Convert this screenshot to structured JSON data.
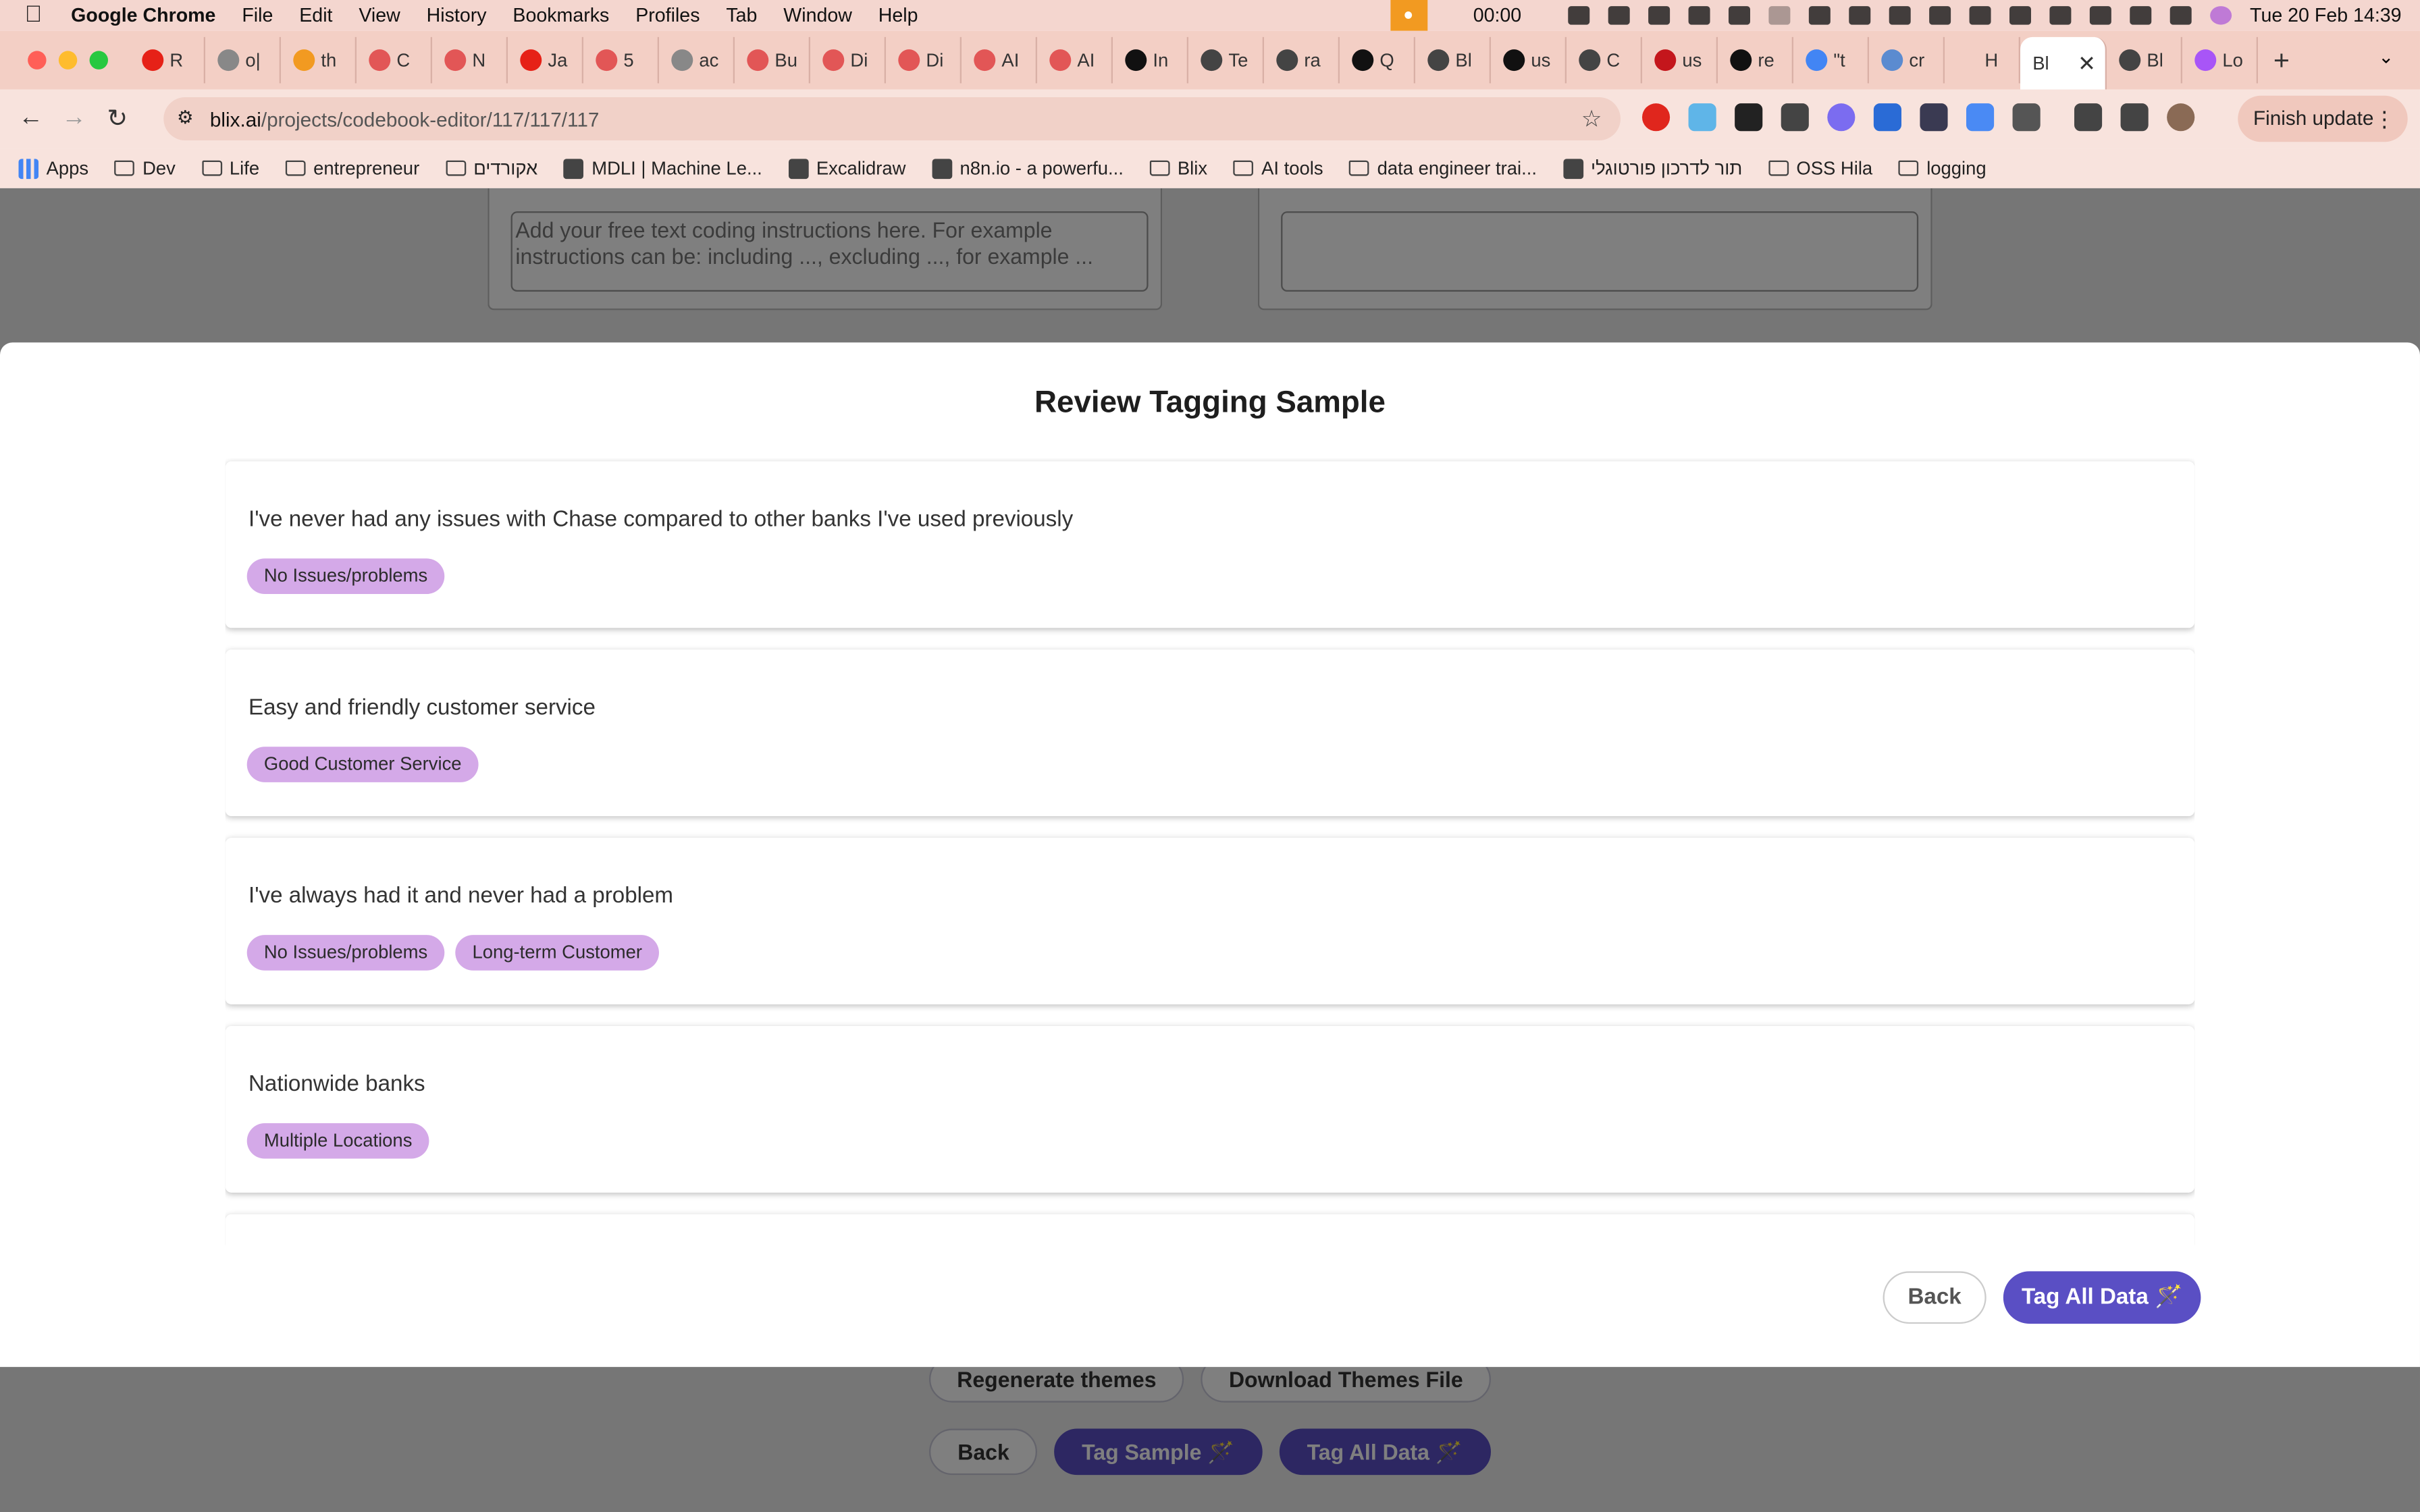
{
  "menubar": {
    "app": "Google Chrome",
    "items": [
      "File",
      "Edit",
      "View",
      "History",
      "Bookmarks",
      "Profiles",
      "Tab",
      "Window",
      "Help"
    ],
    "clock_timer": "00:00",
    "datetime": "Tue 20 Feb  14:39"
  },
  "tabs": [
    {
      "label": "R",
      "color": "#e62117"
    },
    {
      "label": "o|",
      "color": "#888888"
    },
    {
      "label": "th",
      "color": "#f29a21"
    },
    {
      "label": "C",
      "color": "#e25656"
    },
    {
      "label": "N",
      "color": "#e25656"
    },
    {
      "label": "Ja",
      "color": "#e62117"
    },
    {
      "label": "5",
      "color": "#e25656"
    },
    {
      "label": "ac",
      "color": "#888888"
    },
    {
      "label": "Bu",
      "color": "#e25656"
    },
    {
      "label": "Di",
      "color": "#e25656"
    },
    {
      "label": "Di",
      "color": "#e25656"
    },
    {
      "label": "AI",
      "color": "#e25656"
    },
    {
      "label": "AI",
      "color": "#e25656"
    },
    {
      "label": "In",
      "color": "#111111"
    },
    {
      "label": "Te",
      "color": "#444444"
    },
    {
      "label": "ra",
      "color": "#444444"
    },
    {
      "label": "Q",
      "color": "#111111"
    },
    {
      "label": "Bl",
      "color": "#444444"
    },
    {
      "label": "us",
      "color": "#111111"
    },
    {
      "label": "C",
      "color": "#444444"
    },
    {
      "label": "us",
      "color": "#c4161c"
    },
    {
      "label": "re",
      "color": "#111111"
    },
    {
      "label": "\"t",
      "color": "#4285f4"
    },
    {
      "label": "cr",
      "color": "#5b8bd0"
    },
    {
      "label": "H",
      "color": "#f3cfc5"
    }
  ],
  "active_tab": {
    "label": "Bl"
  },
  "tabs_after": [
    {
      "label": "Bl",
      "color": "#444444"
    },
    {
      "label": "Lo",
      "color": "#a855f7"
    }
  ],
  "address": {
    "host": "blix.ai",
    "path": "/projects/codebook-editor/117/117/117"
  },
  "toolbar": {
    "finish_update": "Finish update"
  },
  "bookmarks": [
    {
      "label": "Apps",
      "type": "apps"
    },
    {
      "label": "Dev",
      "type": "folder"
    },
    {
      "label": "Life",
      "type": "folder"
    },
    {
      "label": "entrepreneur",
      "type": "folder"
    },
    {
      "label": "אקורדים",
      "type": "folder"
    },
    {
      "label": "MDLI | Machine Le...",
      "type": "site"
    },
    {
      "label": "Excalidraw",
      "type": "site"
    },
    {
      "label": "n8n.io - a powerfu...",
      "type": "site"
    },
    {
      "label": "Blix",
      "type": "folder"
    },
    {
      "label": "AI tools",
      "type": "folder"
    },
    {
      "label": "data engineer trai...",
      "type": "folder"
    },
    {
      "label": "תור לדרכון פורטוגלי",
      "type": "site"
    },
    {
      "label": "OSS Hila",
      "type": "folder"
    },
    {
      "label": "logging",
      "type": "folder"
    }
  ],
  "background": {
    "instructions_placeholder": "Add your free text coding instructions here. For example instructions can be: including ..., excluding ..., for example ...",
    "buttons_row1": [
      "Regenerate themes",
      "Download Themes File"
    ],
    "buttons_row2": [
      "Back",
      "Tag Sample 🪄",
      "Tag All Data 🪄"
    ]
  },
  "modal": {
    "title": "Review Tagging Sample",
    "samples": [
      {
        "text": "I've never had any issues with Chase compared to other banks I've used previously",
        "tags": [
          "No Issues/problems"
        ]
      },
      {
        "text": "Easy and friendly customer service",
        "tags": [
          "Good Customer Service"
        ]
      },
      {
        "text": "I've always had it and never had a problem",
        "tags": [
          "No Issues/problems",
          "Long-term Customer"
        ]
      },
      {
        "text": "Nationwide banks",
        "tags": [
          "Multiple Locations"
        ]
      },
      {
        "text": "",
        "tags": []
      }
    ],
    "back_label": "Back",
    "tag_all_label": "Tag All Data 🪄"
  }
}
